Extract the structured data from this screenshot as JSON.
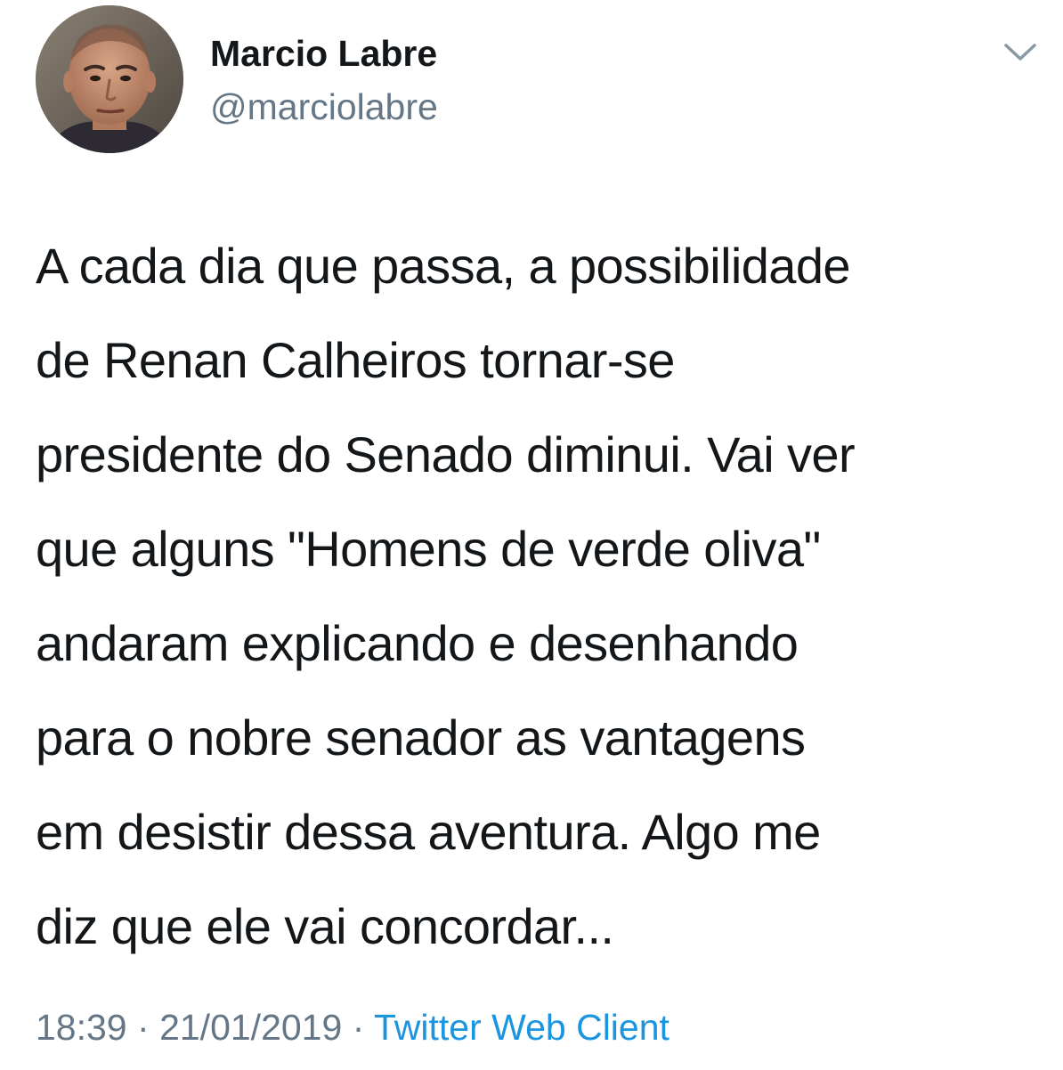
{
  "tweet": {
    "author": {
      "display_name": "Marcio Labre",
      "handle": "@marciolabre",
      "avatar": "profile-photo"
    },
    "menu_icon": "chevron-down-icon",
    "text_lines": [
      "A cada dia que passa, a possibilidade",
      "de Renan Calheiros tornar-se",
      "presidente do Senado diminui. Vai ver",
      "que alguns \"Homens de verde oliva\"",
      "andaram explicando e desenhando",
      "para o nobre senador as vantagens",
      "em desistir dessa aventura. Algo me",
      "diz que ele vai concordar..."
    ],
    "time": "18:39",
    "separator": "·",
    "date": "21/01/2019",
    "source": "Twitter Web Client"
  },
  "colors": {
    "text": "#14171a",
    "secondary": "#657786",
    "link": "#1b95e0",
    "background": "#ffffff"
  }
}
